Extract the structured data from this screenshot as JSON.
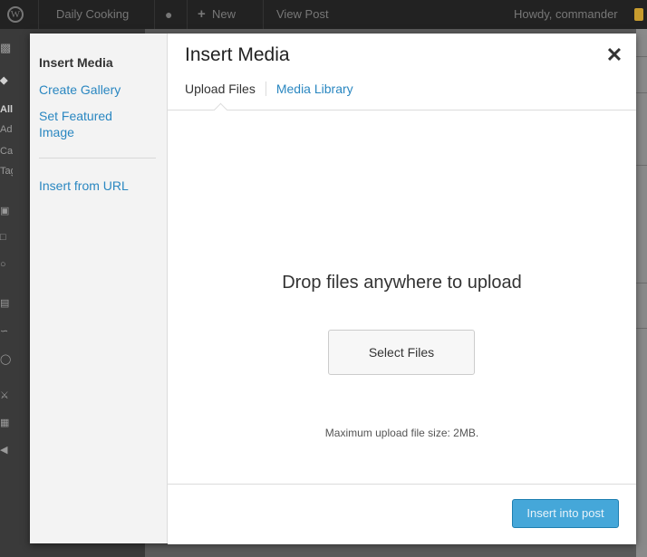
{
  "admin_bar": {
    "site_name": "Daily Cooking",
    "new_label": "New",
    "view_post_label": "View Post",
    "howdy": "Howdy, commander",
    "logo_icon": "wordpress-logo-icon",
    "comments_icon": "speech-bubble-icon",
    "plus_icon": "plus-icon"
  },
  "background_menu_fragments": [
    "All",
    "Add",
    "Cat",
    "Tag"
  ],
  "modal": {
    "sidebar": {
      "heading": "Insert Media",
      "links": [
        "Create Gallery",
        "Set Featured\nImage",
        "Insert from URL"
      ]
    },
    "title": "Insert Media",
    "close_icon": "close-icon",
    "close_glyph": "✕",
    "tabs": {
      "upload": "Upload Files",
      "library": "Media Library"
    },
    "uploader": {
      "drop_text": "Drop files anywhere to upload",
      "select_button": "Select Files",
      "max_size": "Maximum upload file size: 2MB."
    },
    "insert_button": "Insert into post"
  },
  "colors": {
    "link": "#2a87c1",
    "primary_button": "#45a7d9",
    "admin_bar": "#222222"
  }
}
